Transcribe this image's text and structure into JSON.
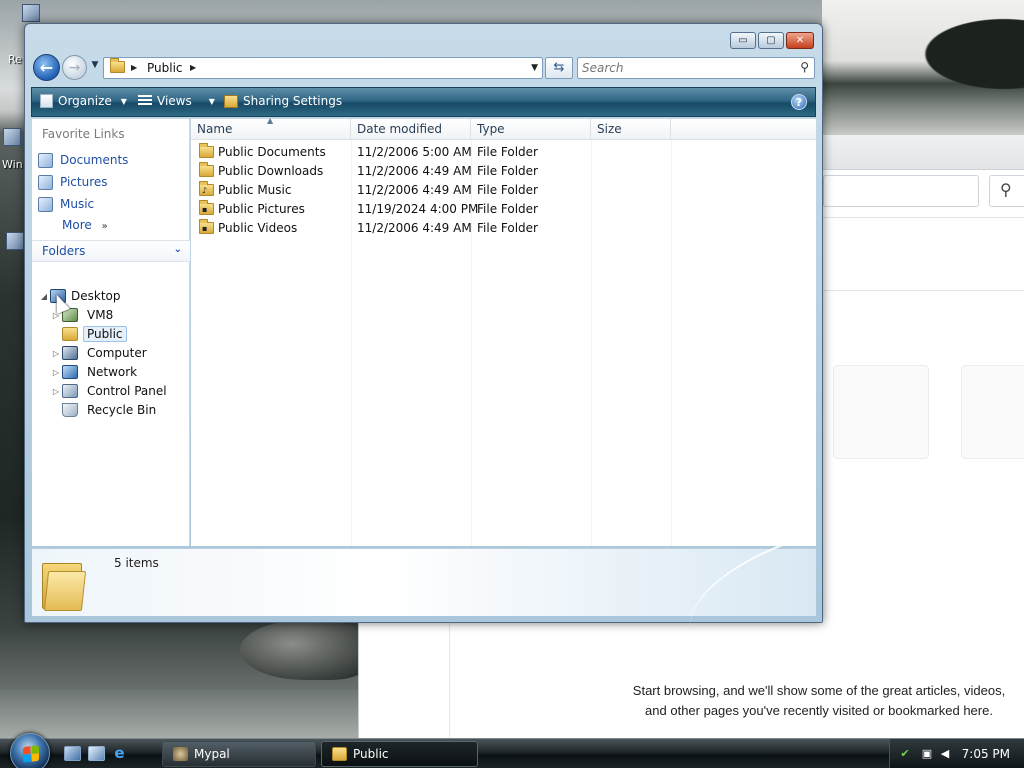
{
  "desktop": {
    "label_re": "Re",
    "label_win": "Win"
  },
  "background_browser": {
    "search_icon": "magnifier-icon",
    "message": "Start browsing, and we'll show some of the great articles, videos, and other pages you've recently visited or bookmarked here."
  },
  "explorer": {
    "caption": {
      "minimize": "▭",
      "maximize": "▢",
      "close": "✕"
    },
    "nav": {
      "back_icon": "back-arrow-icon",
      "forward_icon": "forward-arrow-icon",
      "breadcrumb": "Public",
      "search_placeholder": "Search"
    },
    "commands": {
      "organize": "Organize",
      "views": "Views",
      "sharing": "Sharing Settings",
      "help": "?"
    },
    "favorite_links": {
      "title": "Favorite Links",
      "items": [
        "Documents",
        "Pictures",
        "Music"
      ],
      "more": "More"
    },
    "folders": {
      "title": "Folders",
      "tree": [
        {
          "label": "Desktop"
        },
        {
          "label": "VM8"
        },
        {
          "label": "Public"
        },
        {
          "label": "Computer"
        },
        {
          "label": "Network"
        },
        {
          "label": "Control Panel"
        },
        {
          "label": "Recycle Bin"
        }
      ]
    },
    "columns": [
      "Name",
      "Date modified",
      "Type",
      "Size"
    ],
    "files": [
      {
        "name": "Public Documents",
        "date": "11/2/2006 5:00 AM",
        "type": "File Folder"
      },
      {
        "name": "Public Downloads",
        "date": "11/2/2006 4:49 AM",
        "type": "File Folder"
      },
      {
        "name": "Public Music",
        "date": "11/2/2006 4:49 AM",
        "type": "File Folder"
      },
      {
        "name": "Public Pictures",
        "date": "11/19/2024 4:00 PM",
        "type": "File Folder"
      },
      {
        "name": "Public Videos",
        "date": "11/2/2006 4:49 AM",
        "type": "File Folder"
      }
    ],
    "details": {
      "item_count": "5 items"
    }
  },
  "taskbar": {
    "tasks": [
      {
        "label": "Mypal"
      },
      {
        "label": "Public"
      }
    ],
    "clock": "7:05 PM"
  },
  "colors": {
    "link_blue": "#1e4fa4",
    "command_bar": "#2f6584",
    "close_button": "#c4401d"
  }
}
